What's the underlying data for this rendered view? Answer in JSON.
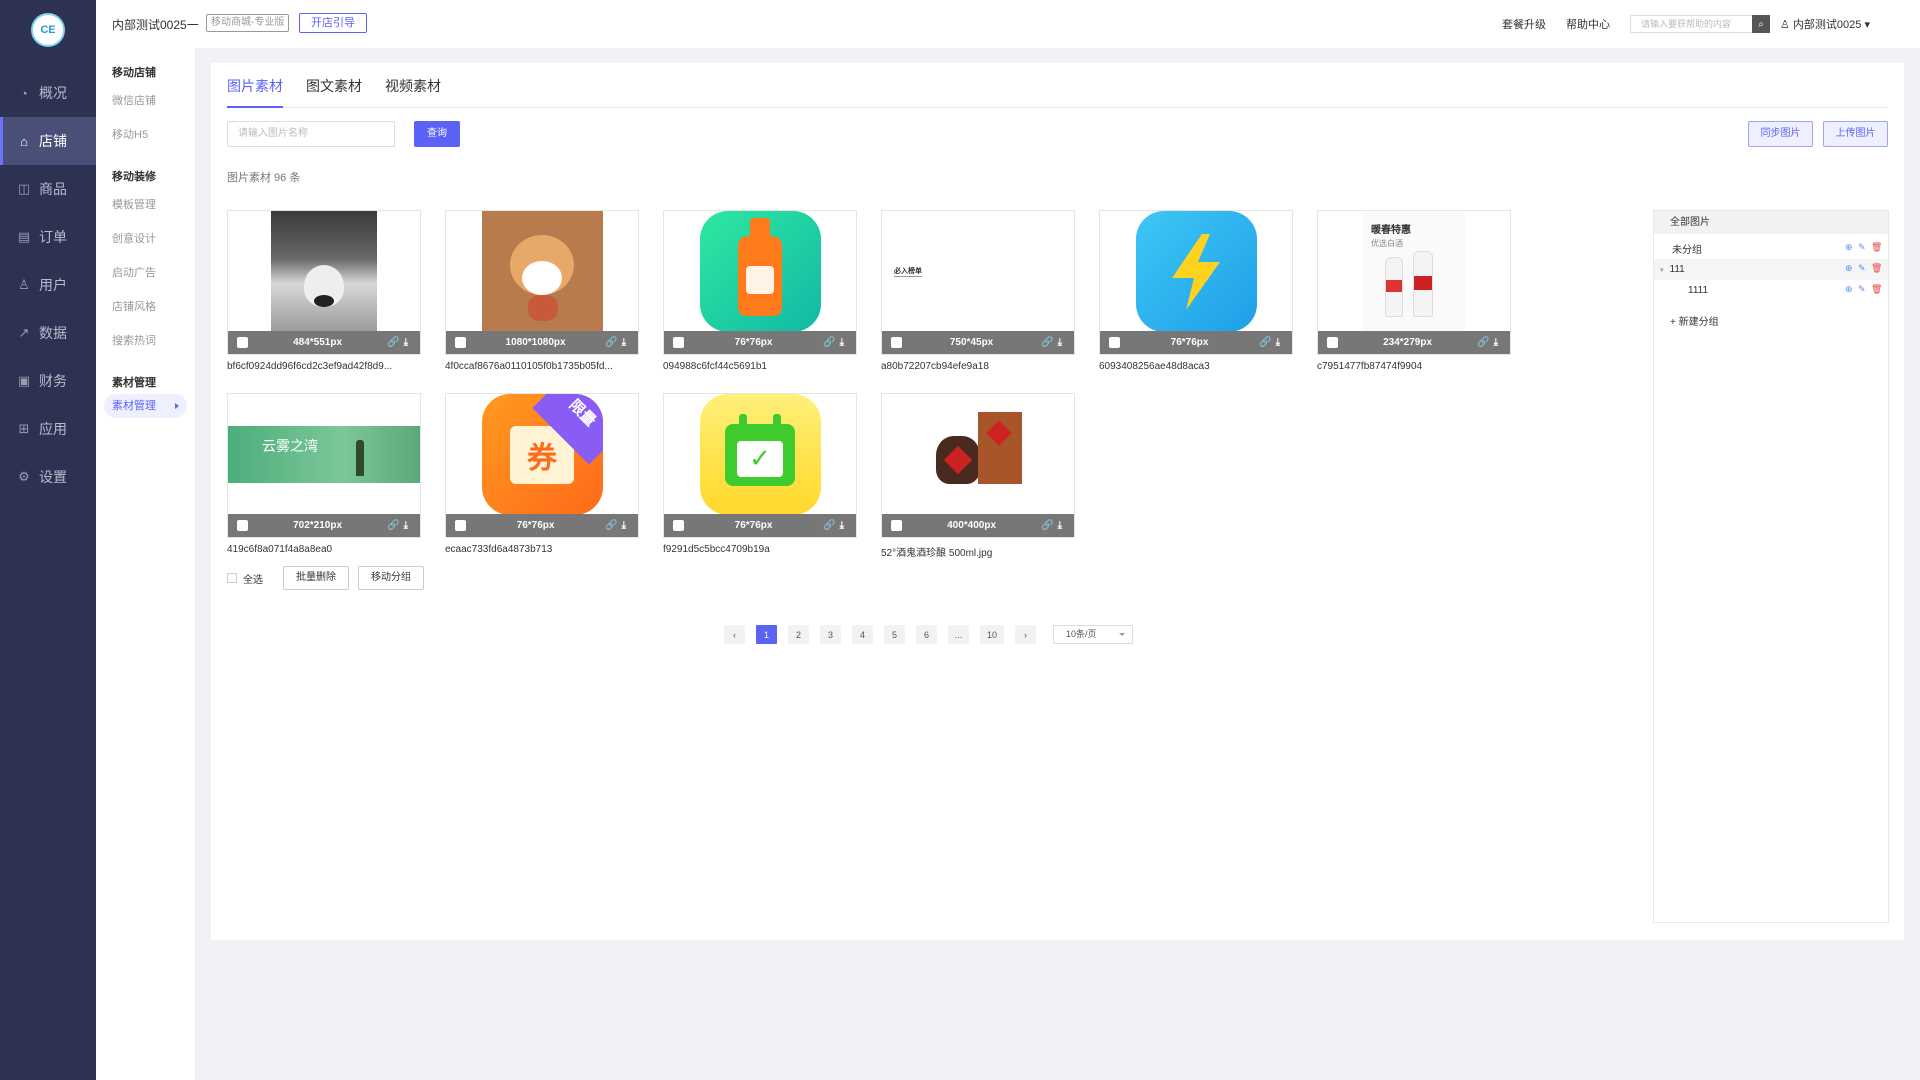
{
  "header": {
    "title": "内部测试0025一",
    "badge": "移动商城-专业版",
    "guide_btn": "开店引导",
    "upgrade": "套餐升级",
    "help": "帮助中心",
    "search_placeholder": "请输入要获帮助的内容",
    "user": "内部测试0025"
  },
  "logo": {
    "text": "CE"
  },
  "sidebar": {
    "items": [
      {
        "label": "概况",
        "icon": "dashboard-icon"
      },
      {
        "label": "店铺",
        "icon": "store-icon"
      },
      {
        "label": "商品",
        "icon": "bag-icon"
      },
      {
        "label": "订单",
        "icon": "order-icon"
      },
      {
        "label": "用户",
        "icon": "user-icon"
      },
      {
        "label": "数据",
        "icon": "chart-icon"
      },
      {
        "label": "财务",
        "icon": "finance-icon"
      },
      {
        "label": "应用",
        "icon": "apps-icon"
      },
      {
        "label": "设置",
        "icon": "settings-icon"
      }
    ]
  },
  "submenu": {
    "g1_title": "移动店铺",
    "g1_items": [
      "微信店铺",
      "移动H5"
    ],
    "g2_title": "移动装修",
    "g2_items": [
      "模板管理",
      "创意设计",
      "启动广告",
      "店铺风格",
      "搜索热词"
    ],
    "g3_title": "素材管理",
    "g3_items": [
      "素材管理"
    ]
  },
  "tabs": [
    "图片素材",
    "图文素材",
    "视频素材"
  ],
  "toolbar": {
    "search_placeholder": "请输入图片名称",
    "query": "查询",
    "sync": "同步图片",
    "upload": "上传图片"
  },
  "count_text": "图片素材 96 条",
  "images": [
    {
      "size": "484*551px",
      "name": "bf6cf0924dd96f6cd2c3ef9ad42f8d9..."
    },
    {
      "size": "1080*1080px",
      "name": "4f0ccaf8676a0110105f0b1735b05fd..."
    },
    {
      "size": "76*76px",
      "name": "094988c6fcf44c5691b1"
    },
    {
      "size": "750*45px",
      "name": "a80b72207cb94efe9a18",
      "inner_text": "必入榜单"
    },
    {
      "size": "76*76px",
      "name": "6093408256ae48d8aca3"
    },
    {
      "size": "234*279px",
      "name": "c7951477fb87474f9904",
      "inner_title": "暖春特惠",
      "inner_sub": "优选白酒"
    },
    {
      "size": "702*210px",
      "name": "419c6f8a071f4a8a8ea0",
      "inner_text": "云雾之湾"
    },
    {
      "size": "76*76px",
      "name": "ecaac733fd6a4873b713",
      "inner_text": "券",
      "inner_tag": "限量"
    },
    {
      "size": "76*76px",
      "name": "f9291d5c5bcc4709b19a"
    },
    {
      "size": "400*400px",
      "name": "52°酒鬼酒珍酿 500ml.jpg"
    }
  ],
  "bulk": {
    "select_all": "全选",
    "batch_delete": "批量删除",
    "move_group": "移动分组"
  },
  "pager": {
    "pages": [
      "1",
      "2",
      "3",
      "4",
      "5",
      "6",
      "...",
      "10"
    ],
    "size": "10条/页"
  },
  "groups": {
    "head": "全部图片",
    "items": [
      "未分组",
      "111",
      "1111"
    ],
    "new_group": "+ 新建分组"
  },
  "colors": {
    "accent": "#5b63f5",
    "sidebar": "#2d3152"
  }
}
